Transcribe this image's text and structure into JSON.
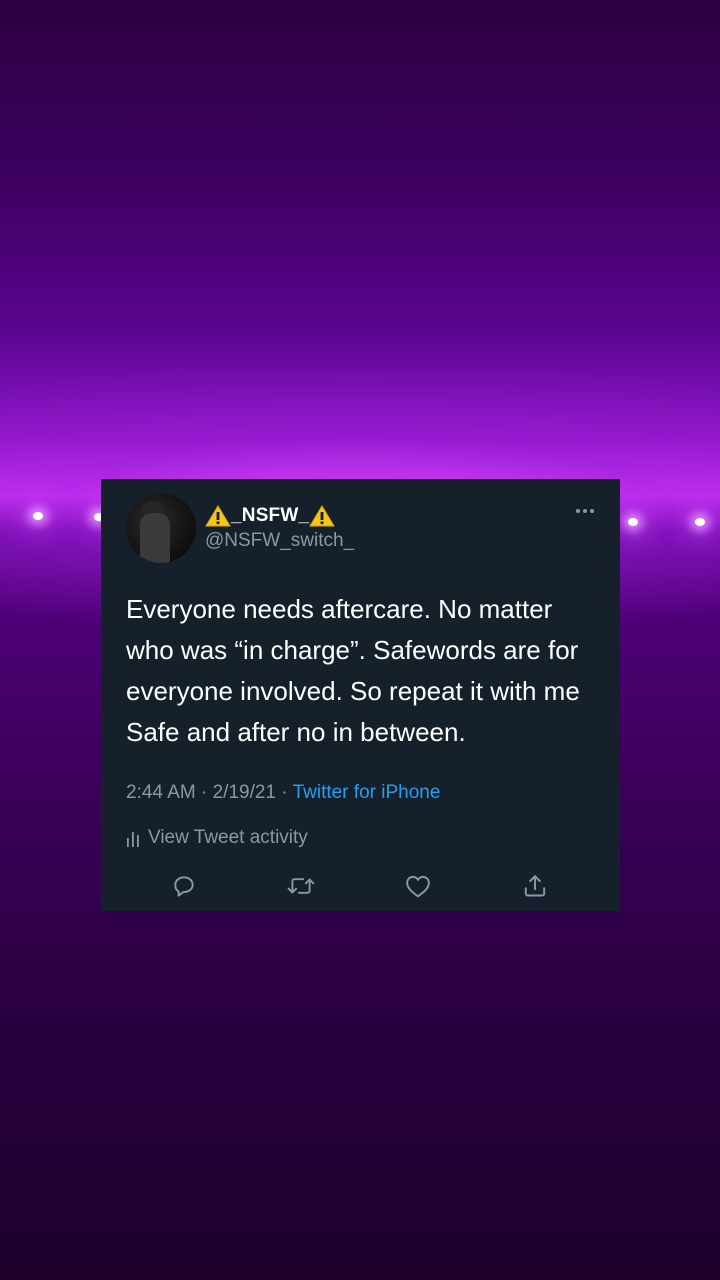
{
  "tweet": {
    "display_name": "_NSFW_",
    "handle": "@NSFW_switch_",
    "text": "Everyone needs aftercare. No matter who was “in charge”. Safewords are for everyone involved. So repeat it with me Safe and after no in between.",
    "time": "2:44 AM",
    "separator1": " · ",
    "date": "2/19/21",
    "separator2": " · ",
    "source": "Twitter for iPhone",
    "activity_label": "View Tweet activity"
  },
  "icons": {
    "name_prefix": "warning-icon",
    "name_suffix": "warning-icon",
    "more": "more-icon",
    "activity": "bar-chart-icon",
    "reply": "reply-icon",
    "retweet": "retweet-icon",
    "like": "heart-icon",
    "share": "share-icon"
  },
  "colors": {
    "card_background": "#15202b",
    "primary_text": "#ffffff",
    "secondary_text": "#8899a6",
    "link": "#1da1f2",
    "background_glow": "#c22ff0"
  }
}
